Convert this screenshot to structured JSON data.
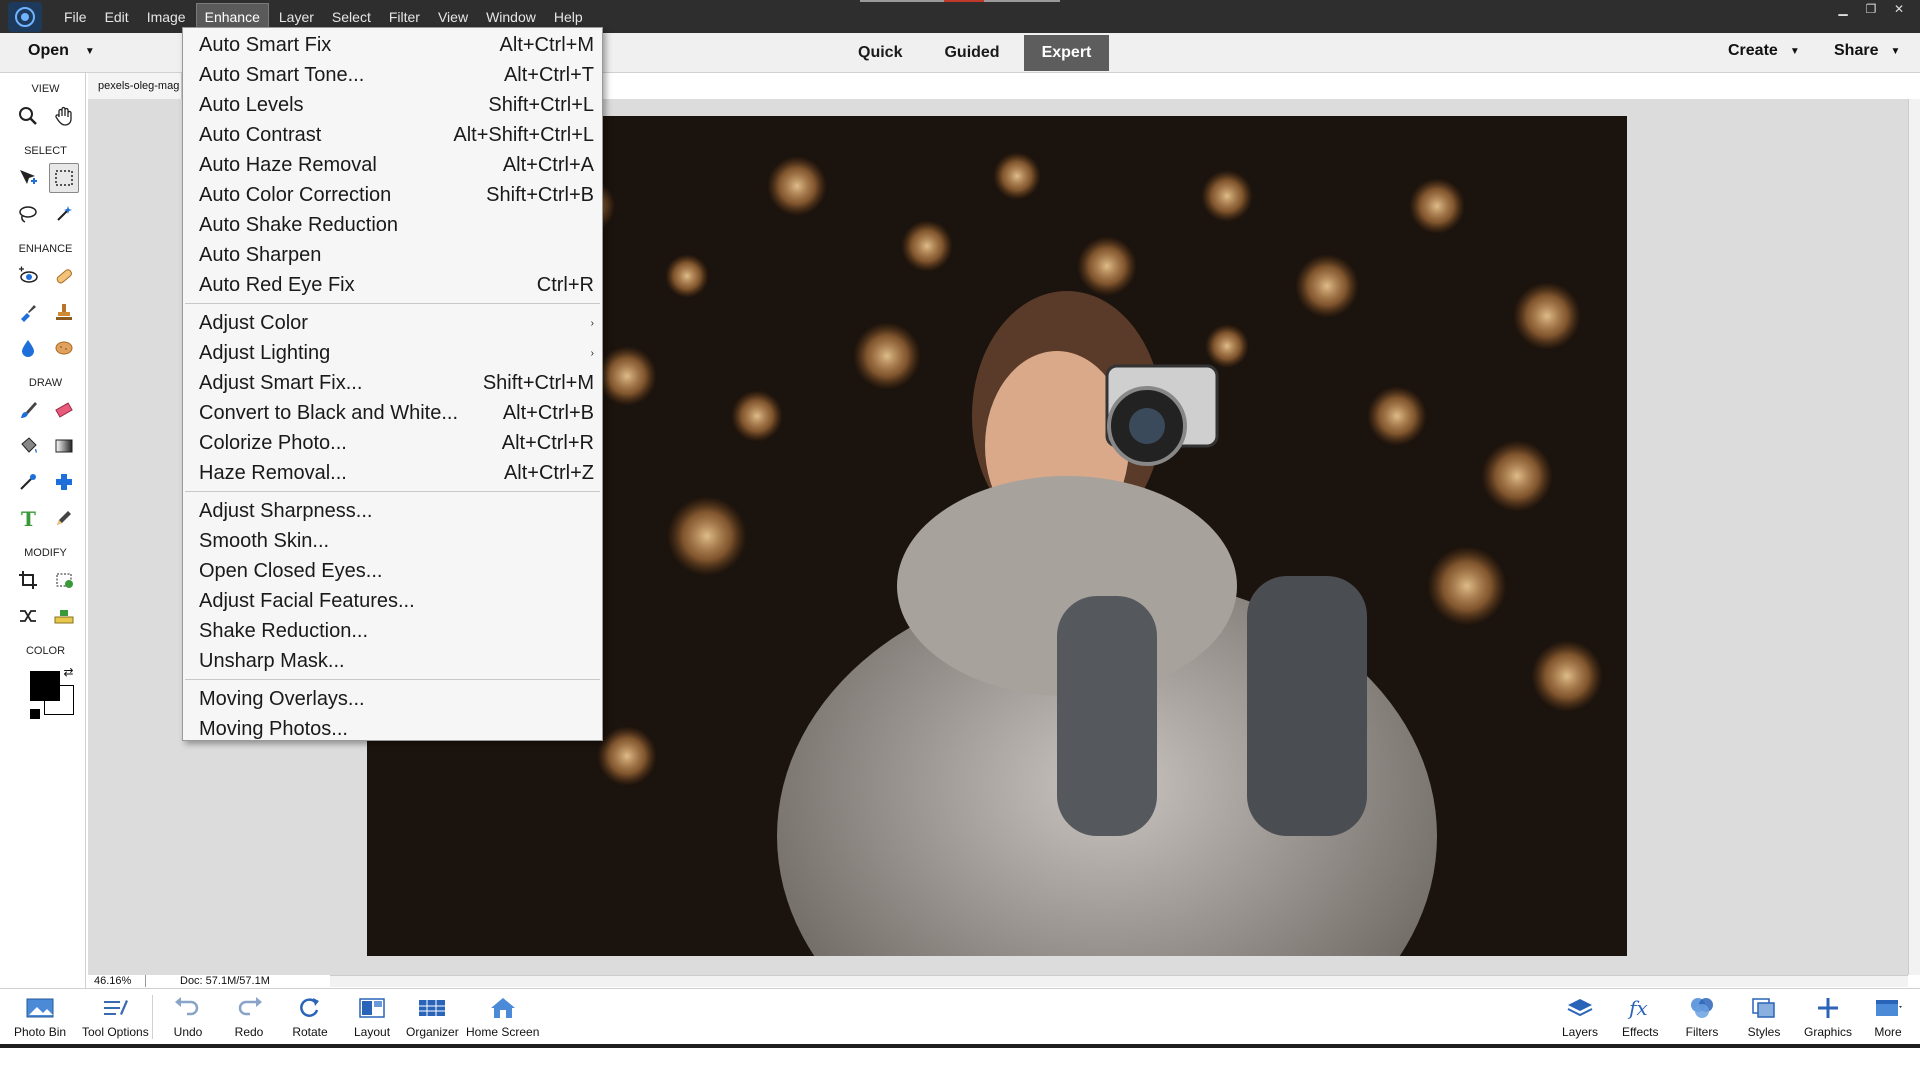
{
  "menubar": {
    "items": [
      "File",
      "Edit",
      "Image",
      "Enhance",
      "Layer",
      "Select",
      "Filter",
      "View",
      "Window",
      "Help"
    ],
    "active": "Enhance"
  },
  "window_controls": {
    "minimize": "▁",
    "restore": "❐",
    "close": "✕"
  },
  "modebar": {
    "open_label": "Open",
    "tabs": [
      "Quick",
      "Guided",
      "Expert"
    ],
    "active_tab": "Expert",
    "create_label": "Create",
    "share_label": "Share"
  },
  "tools": {
    "sections": {
      "view": "VIEW",
      "select": "SELECT",
      "enhance": "ENHANCE",
      "draw": "DRAW",
      "modify": "MODIFY",
      "color": "COLOR"
    }
  },
  "document": {
    "tab_name": "pexels-oleg-mag",
    "zoom": "46.16%",
    "doc_info": "Doc: 57.1M/57.1M"
  },
  "enhance_menu": {
    "group1": [
      {
        "label": "Auto Smart Fix",
        "shortcut": "Alt+Ctrl+M"
      },
      {
        "label": "Auto Smart Tone...",
        "shortcut": "Alt+Ctrl+T"
      },
      {
        "label": "Auto Levels",
        "shortcut": "Shift+Ctrl+L"
      },
      {
        "label": "Auto Contrast",
        "shortcut": "Alt+Shift+Ctrl+L"
      },
      {
        "label": "Auto Haze Removal",
        "shortcut": "Alt+Ctrl+A"
      },
      {
        "label": "Auto Color Correction",
        "shortcut": "Shift+Ctrl+B"
      },
      {
        "label": "Auto Shake Reduction",
        "shortcut": ""
      },
      {
        "label": "Auto Sharpen",
        "shortcut": ""
      },
      {
        "label": "Auto Red Eye Fix",
        "shortcut": "Ctrl+R"
      }
    ],
    "group2": [
      {
        "label": "Adjust Color",
        "shortcut": "›"
      },
      {
        "label": "Adjust Lighting",
        "shortcut": "›"
      },
      {
        "label": "Adjust Smart Fix...",
        "shortcut": "Shift+Ctrl+M"
      },
      {
        "label": "Convert to Black and White...",
        "shortcut": "Alt+Ctrl+B"
      },
      {
        "label": "Colorize Photo...",
        "shortcut": "Alt+Ctrl+R"
      },
      {
        "label": "Haze Removal...",
        "shortcut": "Alt+Ctrl+Z"
      }
    ],
    "group3": [
      {
        "label": "Adjust Sharpness...",
        "shortcut": ""
      },
      {
        "label": "Smooth Skin...",
        "shortcut": ""
      },
      {
        "label": "Open Closed Eyes...",
        "shortcut": ""
      },
      {
        "label": "Adjust Facial Features...",
        "shortcut": ""
      },
      {
        "label": "Shake Reduction...",
        "shortcut": ""
      },
      {
        "label": "Unsharp Mask...",
        "shortcut": ""
      }
    ],
    "group4": [
      {
        "label": "Moving Overlays...",
        "shortcut": ""
      },
      {
        "label": "Moving Photos...",
        "shortcut": ""
      }
    ]
  },
  "taskbar": {
    "left": [
      "Photo Bin",
      "Tool Options",
      "Undo",
      "Redo",
      "Rotate",
      "Layout",
      "Organizer",
      "Home Screen"
    ],
    "right": [
      "Layers",
      "Effects",
      "Filters",
      "Styles",
      "Graphics",
      "More"
    ]
  },
  "colors": {
    "menubar_bg": "#2e2e2e",
    "active_tab_bg": "#5d5d5d",
    "accent_blue": "#1e6fd9",
    "foreground_color": "#000000",
    "background_color": "#ffffff"
  }
}
